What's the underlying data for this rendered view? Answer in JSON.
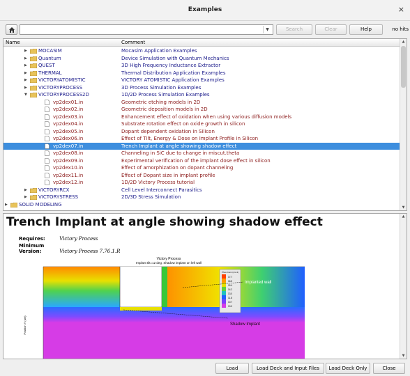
{
  "window": {
    "title": "Examples",
    "close_glyph": "×"
  },
  "toolbar": {
    "search_label": "Search",
    "clear_label": "Clear",
    "help_label": "Help",
    "hits_text": "no hits",
    "combo_value": ""
  },
  "tree": {
    "columns": [
      "Name",
      "Comment"
    ],
    "rows": [
      {
        "name": "MOCASIM",
        "comment": "Mocasim Application Examples",
        "kind": "folder",
        "state": "collapsed"
      },
      {
        "name": "Quantum",
        "comment": "Device Simulation with Quantum Mechanics",
        "kind": "folder",
        "state": "collapsed"
      },
      {
        "name": "QUEST",
        "comment": "3D High Frequency Inductance Extractor",
        "kind": "folder",
        "state": "collapsed"
      },
      {
        "name": "THERMAL",
        "comment": "Thermal Distribution Application Examples",
        "kind": "folder",
        "state": "collapsed"
      },
      {
        "name": "VICTORYATOMISTIC",
        "comment": "VICTORY ATOMISTIC Application Examples",
        "kind": "folder",
        "state": "collapsed"
      },
      {
        "name": "VICTORYPROCESS",
        "comment": "3D Process Simulation Examples",
        "kind": "folder",
        "state": "collapsed"
      },
      {
        "name": "VICTORYPROCESS2D",
        "comment": "1D/2D Process Simulation Examples",
        "kind": "folder",
        "state": "expanded"
      },
      {
        "name": "vp2dex01.in",
        "comment": "Geometric etching models in 2D",
        "kind": "file"
      },
      {
        "name": "vp2dex02.in",
        "comment": "Geometric deposition models in 2D",
        "kind": "file"
      },
      {
        "name": "vp2dex03.in",
        "comment": "Enhancement effect of oxidation when using various diffusion models",
        "kind": "file"
      },
      {
        "name": "vp2dex04.in",
        "comment": "Substrate rotation effect on oxide growth in silicon",
        "kind": "file"
      },
      {
        "name": "vp2dex05.in",
        "comment": "Dopant dependent oxidation in Silicon",
        "kind": "file"
      },
      {
        "name": "vp2dex06.in",
        "comment": "Effect of Tilt, Energy & Dose on Implant Profile in Silicon",
        "kind": "file"
      },
      {
        "name": "vp2dex07.in",
        "comment": "Trench Implant at angle showing shadow effect",
        "kind": "file",
        "selected": true
      },
      {
        "name": "vp2dex08.in",
        "comment": "Channeling in SiC due to change in miscut.theta",
        "kind": "file"
      },
      {
        "name": "vp2dex09.in",
        "comment": "Experimental verification of the implant dose effect in silicon",
        "kind": "file"
      },
      {
        "name": "vp2dex10.in",
        "comment": "Effect of amorphization on dopant channeling",
        "kind": "file"
      },
      {
        "name": "vp2dex11.in",
        "comment": "Effect of Dopant size in implant profile",
        "kind": "file"
      },
      {
        "name": "vp2dex12.in",
        "comment": "1D/2D Victory Process tutorial",
        "kind": "file"
      },
      {
        "name": "VICTORYRCX",
        "comment": "Cell Level Interconnect Parasitics",
        "kind": "folder",
        "state": "collapsed"
      },
      {
        "name": "VICTORYSTRESS",
        "comment": "2D/3D Stress Simulation",
        "kind": "folder",
        "state": "collapsed"
      },
      {
        "name": "SOLID MODELING",
        "comment": "",
        "kind": "folder",
        "state": "collapsed",
        "level": 0
      }
    ]
  },
  "detail": {
    "heading": "Trench Implant at angle showing shadow effect",
    "requires_label": "Requires:",
    "requires_value": "Victory Process",
    "min_version_label": "Minimum Version:",
    "min_version_value": "Victory Process 7.76.1.R",
    "figure": {
      "title": "Victory Process",
      "subtitle": "Implant tilt=12 deg. Shadow implant on left wall",
      "annotation_wall": "Implanted wall",
      "annotation_shadow": "Shadow Implant",
      "legend_title": "Phos Conc (cm-3)",
      "legend_values": [
        "17.7",
        "16.5",
        "15.4",
        "14.2",
        "13.0",
        "11.8",
        "10.7",
        "10.0"
      ],
      "y_axis_label": "Position Y (um)"
    }
  },
  "buttons": {
    "load": "Load",
    "load_deck_input": "Load Deck and Input Files",
    "load_deck_only": "Load Deck Only",
    "close": "Close"
  },
  "colors": {
    "selection": "#3d8ede",
    "folder_text": "#1a1a8a",
    "file_text": "#8b1a1a",
    "folder_icon": "#e8c35a"
  }
}
